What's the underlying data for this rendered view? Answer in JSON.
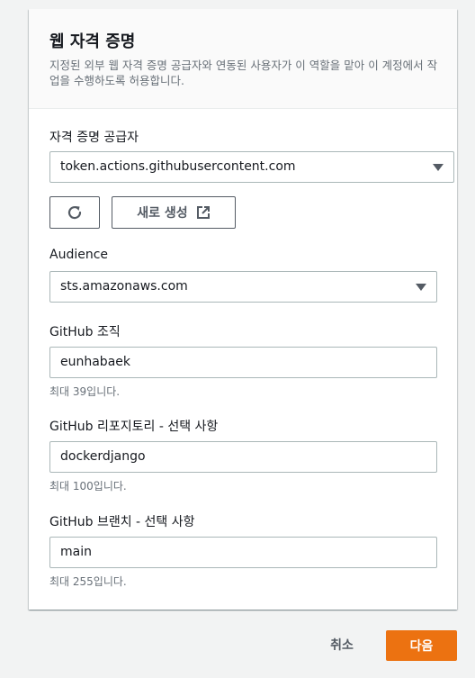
{
  "section": {
    "title": "웹 자격 증명",
    "description": "지정된 외부 웹 자격 증명 공급자와 연동된 사용자가 이 역할을 맡아 이 계정에서 작업을 수행하도록 허용합니다."
  },
  "identity_provider": {
    "label": "자격 증명 공급자",
    "value": "token.actions.githubusercontent.com",
    "refresh_icon": "refresh-icon",
    "create_new_label": "새로 생성",
    "external_icon": "external-link-icon"
  },
  "audience": {
    "label": "Audience",
    "value": "sts.amazonaws.com"
  },
  "github_org": {
    "label": "GitHub 조직",
    "value": "eunhabaek",
    "hint": "최대 39입니다."
  },
  "github_repo": {
    "label": "GitHub 리포지토리 - 선택 사항",
    "value": "dockerdjango",
    "hint": "최대 100입니다."
  },
  "github_branch": {
    "label": "GitHub 브랜치 - 선택 사항",
    "value": "main",
    "hint": "최대 255입니다."
  },
  "footer": {
    "cancel_label": "취소",
    "next_label": "다음"
  },
  "colors": {
    "primary_button": "#ec7211",
    "background": "#f2f3f3",
    "border": "#aab7b8"
  }
}
